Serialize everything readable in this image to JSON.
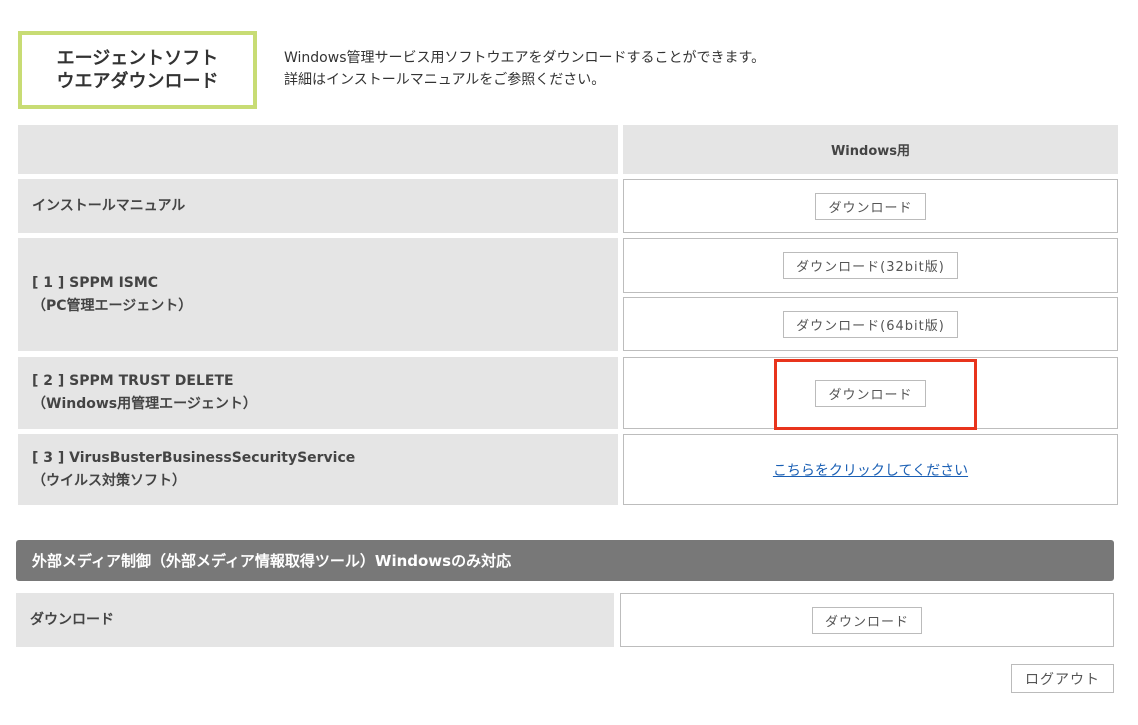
{
  "header": {
    "title_line1": "エージェントソフト",
    "title_line2": "ウエアダウンロード",
    "description_line1": "Windows管理サービス用ソフトウエアをダウンロードすることができます。",
    "description_line2": "詳細はインストールマニュアルをご参照ください。"
  },
  "table": {
    "column_header": "Windows用",
    "rows": [
      {
        "label_line1": "インストールマニュアル",
        "button": "ダウンロード"
      },
      {
        "label_line1": "[ 1 ] SPPM ISMC",
        "label_line2": "（PC管理エージェント）",
        "button_32": "ダウンロード(32bit版)",
        "button_64": "ダウンロード(64bit版)"
      },
      {
        "label_line1": "[ 2 ] SPPM TRUST DELETE",
        "label_line2": "（Windows用管理エージェント）",
        "button": "ダウンロード"
      },
      {
        "label_line1": "[ 3 ] VirusBusterBusinessSecurityService",
        "label_line2": "（ウイルス対策ソフト）",
        "link": "こちらをクリックしてください"
      }
    ]
  },
  "external_media": {
    "section_title": "外部メディア制御（外部メディア情報取得ツール）Windowsのみ対応",
    "row_label": "ダウンロード",
    "button": "ダウンロード"
  },
  "footer": {
    "logout_label": "ログアウト"
  },
  "colors": {
    "title_border": "#c8dc74",
    "highlight": "#e8341c",
    "section_bar": "#787878",
    "link": "#1a5fb4"
  }
}
